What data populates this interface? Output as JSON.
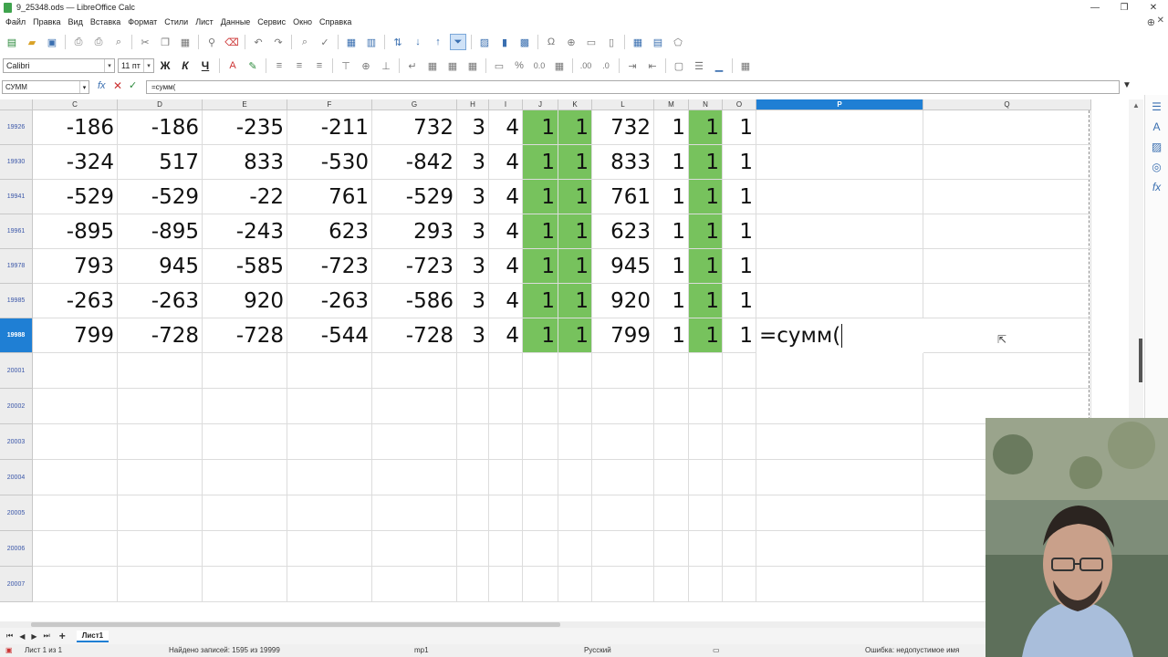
{
  "window": {
    "title": "9_25348.ods — LibreOffice Calc"
  },
  "menu": [
    "Файл",
    "Правка",
    "Вид",
    "Вставка",
    "Формат",
    "Стили",
    "Лист",
    "Данные",
    "Сервис",
    "Окно",
    "Справка"
  ],
  "format_toolbar": {
    "font_name": "Calibri",
    "font_size": "11 пт",
    "bold": "Ж",
    "italic": "К",
    "underline": "Ч",
    "percent": "%",
    "number": "0.0",
    "decimals_add": ".00",
    "decimals_remove": ".0"
  },
  "formula_bar": {
    "name_box": "СУММ",
    "fx": "fx",
    "cancel": "✕",
    "accept": "✓",
    "content": "=сумм("
  },
  "columns": [
    {
      "name": "C",
      "selected": false
    },
    {
      "name": "D",
      "selected": false
    },
    {
      "name": "E",
      "selected": false
    },
    {
      "name": "F",
      "selected": false
    },
    {
      "name": "G",
      "selected": false
    },
    {
      "name": "H",
      "selected": false
    },
    {
      "name": "I",
      "selected": false
    },
    {
      "name": "J",
      "selected": false
    },
    {
      "name": "K",
      "selected": false
    },
    {
      "name": "L",
      "selected": false
    },
    {
      "name": "M",
      "selected": false
    },
    {
      "name": "N",
      "selected": false
    },
    {
      "name": "O",
      "selected": false
    },
    {
      "name": "P",
      "selected": true
    },
    {
      "name": "Q",
      "selected": false
    }
  ],
  "rows": [
    {
      "num": "19926",
      "selected": false,
      "cells": [
        "-186",
        "-186",
        "-235",
        "-211",
        "732",
        "3",
        "4",
        "1",
        "1",
        "732",
        "1",
        "1",
        "1",
        "",
        ""
      ]
    },
    {
      "num": "19930",
      "selected": false,
      "cells": [
        "-324",
        "517",
        "833",
        "-530",
        "-842",
        "3",
        "4",
        "1",
        "1",
        "833",
        "1",
        "1",
        "1",
        "",
        ""
      ]
    },
    {
      "num": "19941",
      "selected": false,
      "cells": [
        "-529",
        "-529",
        "-22",
        "761",
        "-529",
        "3",
        "4",
        "1",
        "1",
        "761",
        "1",
        "1",
        "1",
        "",
        ""
      ]
    },
    {
      "num": "19961",
      "selected": false,
      "cells": [
        "-895",
        "-895",
        "-243",
        "623",
        "293",
        "3",
        "4",
        "1",
        "1",
        "623",
        "1",
        "1",
        "1",
        "",
        ""
      ]
    },
    {
      "num": "19978",
      "selected": false,
      "cells": [
        "793",
        "945",
        "-585",
        "-723",
        "-723",
        "3",
        "4",
        "1",
        "1",
        "945",
        "1",
        "1",
        "1",
        "",
        ""
      ]
    },
    {
      "num": "19985",
      "selected": false,
      "cells": [
        "-263",
        "-263",
        "920",
        "-263",
        "-586",
        "3",
        "4",
        "1",
        "1",
        "920",
        "1",
        "1",
        "1",
        "",
        ""
      ]
    },
    {
      "num": "19988",
      "selected": true,
      "cells": [
        "799",
        "-728",
        "-728",
        "-544",
        "-728",
        "3",
        "4",
        "1",
        "1",
        "799",
        "1",
        "1",
        "1",
        "=сумм(",
        ""
      ]
    },
    {
      "num": "20001",
      "selected": false,
      "cells": []
    },
    {
      "num": "20002",
      "selected": false,
      "cells": []
    },
    {
      "num": "20003",
      "selected": false,
      "cells": []
    },
    {
      "num": "20004",
      "selected": false,
      "cells": []
    },
    {
      "num": "20005",
      "selected": false,
      "cells": []
    },
    {
      "num": "20006",
      "selected": false,
      "cells": []
    },
    {
      "num": "20007",
      "selected": false,
      "cells": []
    }
  ],
  "highlight": {
    "color": "#77c25d",
    "columns": [
      "J",
      "K",
      "N"
    ]
  },
  "sheet_tabs": {
    "active": "Лист1"
  },
  "status": {
    "sheet": "Лист 1 из 1",
    "records": "Найдено записей: 1595 из 19999",
    "page_style": "mp1",
    "language": "Русский",
    "error": "Ошибка: недопустимое имя"
  },
  "colors": {
    "selection": "#1f7fd4",
    "header_bg": "#ededed"
  }
}
